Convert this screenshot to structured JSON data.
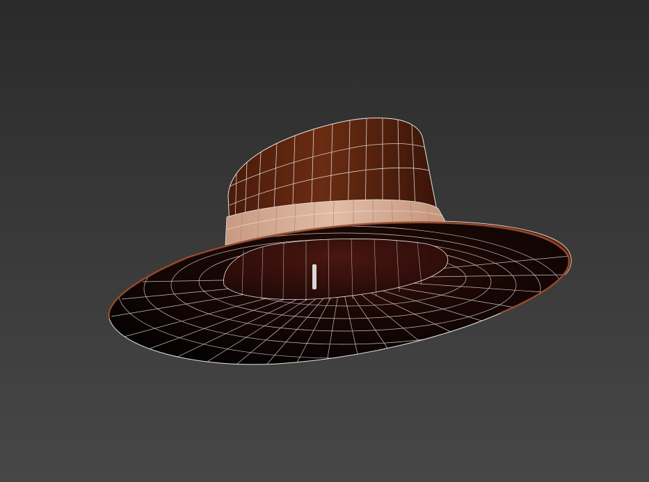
{
  "viewport": {
    "mode": "3d-perspective",
    "shading": "textured-with-wireframe-edges",
    "background_colors": {
      "top": "#2a2a2a",
      "bottom": "#474747"
    }
  },
  "model": {
    "object": "hat",
    "parts": [
      "hat-crown",
      "hat-band",
      "hat-brim",
      "hat-brim-underside",
      "hat-inner-opening"
    ],
    "colors": {
      "crown": "#5a2410",
      "crown_dark": "#3a1408",
      "band": "#d4aa92",
      "brim_top": "#4a1a0c",
      "brim_edge": "#7a3418",
      "underside": "#080303",
      "underside_mid": "#3a120a",
      "wire": "#e8e8e8"
    }
  }
}
